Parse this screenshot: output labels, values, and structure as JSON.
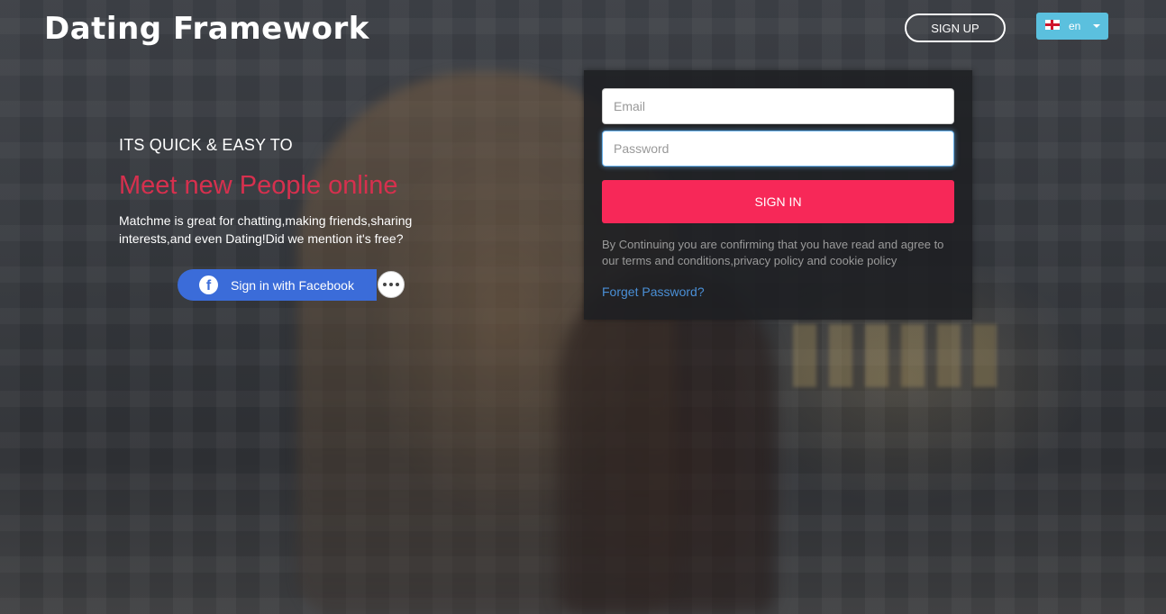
{
  "header": {
    "logo_text": "Dating Framework",
    "signup_label": "SIGN UP",
    "language": "en"
  },
  "hero": {
    "tagline": "ITS QUICK & EASY TO",
    "headline": "Meet new People online",
    "description": "Matchme is great for chatting,making friends,sharing interests,and even Dating!Did we mention it's free?",
    "facebook_label": "Sign in with Facebook"
  },
  "login": {
    "email_placeholder": "Email",
    "password_placeholder": "Password",
    "signin_label": "SIGN IN",
    "terms_text": "By Continuing you are confirming that you have read and agree to our terms and conditions,privacy policy and cookie policy",
    "forget_password_label": "Forget Password?"
  },
  "colors": {
    "accent_pink": "#f72858",
    "headline_red": "#d6304e",
    "facebook_blue": "#3b6cd9",
    "lang_button": "#5bc0de",
    "link_blue": "#4a8fd6"
  },
  "icons": {
    "flag": "england-flag-icon",
    "facebook": "facebook-icon",
    "more": "more-dots-icon",
    "caret": "caret-down-icon"
  }
}
